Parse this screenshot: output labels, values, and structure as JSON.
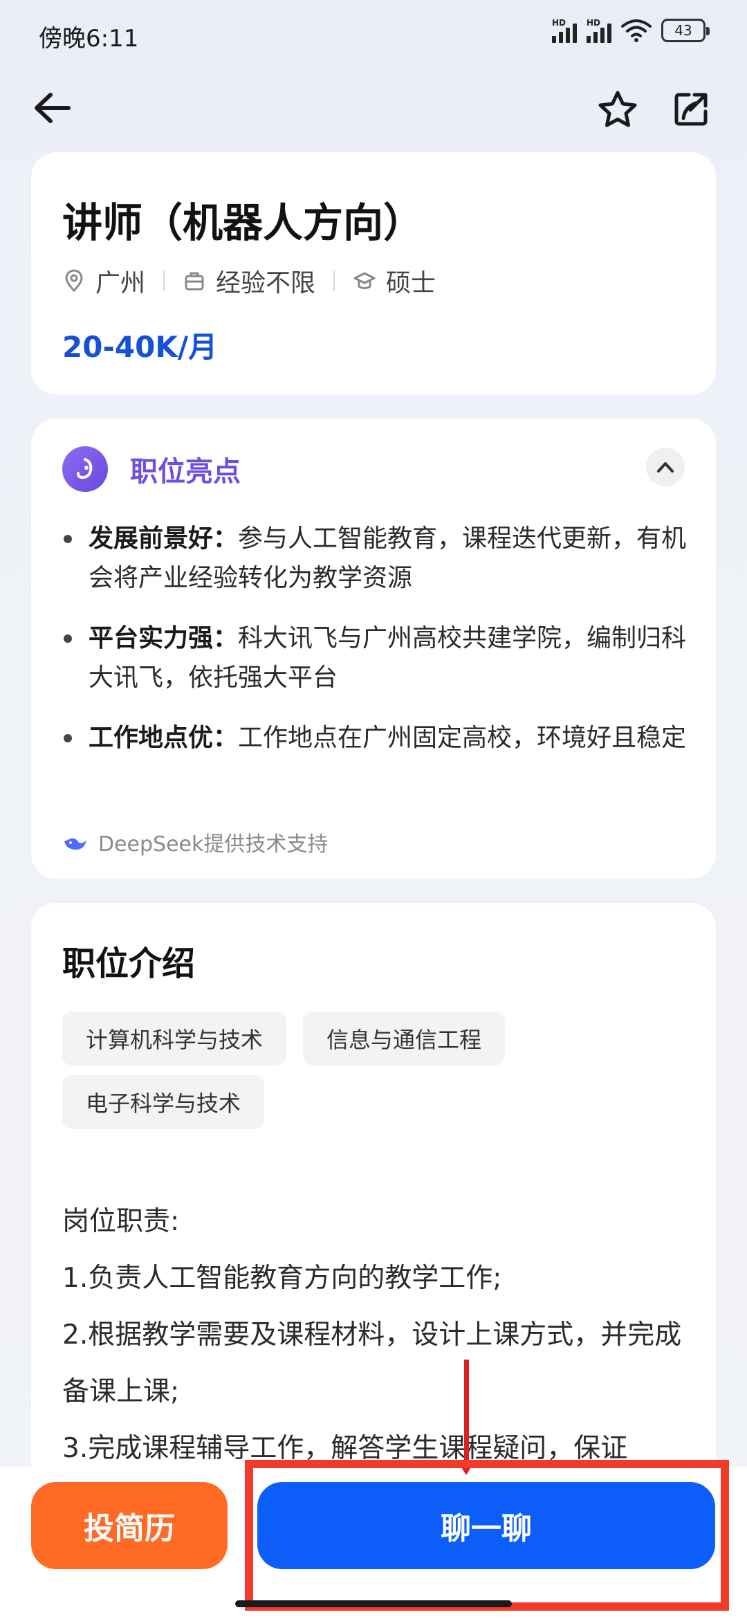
{
  "status_bar": {
    "time": "傍晚6:11",
    "battery": "43",
    "hd1": "HD",
    "hd2": "HD"
  },
  "job": {
    "title": "讲师（机器人方向）",
    "location": "广州",
    "experience": "经验不限",
    "education": "硕士",
    "salary": "20-40K/月"
  },
  "highlights": {
    "title": "职位亮点",
    "items": [
      {
        "label": "发展前景好：",
        "text": "参与人工智能教育，课程迭代更新，有机会将产业经验转化为教学资源"
      },
      {
        "label": "平台实力强：",
        "text": "科大讯飞与广州高校共建学院，编制归科大讯飞，依托强大平台"
      },
      {
        "label": "工作地点优：",
        "text": "工作地点在广州固定高校，环境好且稳定"
      }
    ],
    "credit": "DeepSeek提供技术支持"
  },
  "intro": {
    "title": "职位介绍",
    "tags": [
      "计算机科学与技术",
      "信息与通信工程",
      "电子科学与技术"
    ],
    "lines": [
      "岗位职责:",
      "1.负责人工智能教育方向的教学工作;",
      "2.根据教学需要及课程材料，设计上课方式，并完成备课上课;",
      "3.完成课程辅导工作，解答学生课程疑问，保证"
    ]
  },
  "actions": {
    "apply": "投简历",
    "chat": "聊一聊"
  },
  "colors": {
    "salary": "#1450d8",
    "apply": "#ff6a24",
    "chat": "#0d5ef8",
    "highlight": "#6e4fe0",
    "annotation": "#f23a2a"
  }
}
